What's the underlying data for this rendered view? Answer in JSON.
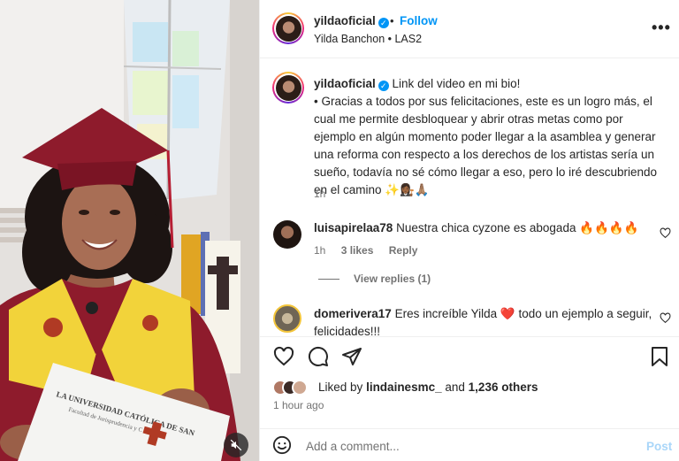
{
  "header": {
    "username": "yildaoficial",
    "separator": "•",
    "follow_label": "Follow",
    "subtitle": "Yilda Banchon • LAS2",
    "more_icon": "more-horizontal-icon"
  },
  "caption": {
    "username": "yildaoficial",
    "lines": [
      "Link del video en mi bio!",
      "• Gracias a todos por sus felicitaciones, este es un logro más, el",
      "cual me permite desbloquear y abrir otras metas como por",
      "ejemplo en algún momento poder llegar a la asamblea y generar",
      "una reforma con respecto a los derechos de los artistas sería un",
      "sueño, todavía no sé cómo llegar a eso, pero lo iré descubriendo",
      "en el camino ✨👩🏾‍⚖️🙏🏽"
    ],
    "time": "1h"
  },
  "comments": [
    {
      "username": "luisapirelaa78",
      "text": "Nuestra chica cyzone es abogada 🔥🔥🔥🔥",
      "time": "1h",
      "likes": "3 likes",
      "reply_label": "Reply",
      "view_replies": "View replies (1)"
    },
    {
      "username": "domerivera17",
      "text_line1": "Eres increíble Yilda ❤️ todo un ejemplo a seguir,",
      "text_line2": "felicidades!!!"
    }
  ],
  "likes": {
    "prefix": "Liked by",
    "user": "lindainesmc_",
    "conjunction": "and",
    "others": "1,236 others"
  },
  "post_time": "1 hour ago",
  "add_comment": {
    "placeholder": "Add a comment...",
    "post_label": "Post"
  },
  "media": {
    "mute_icon": "speaker-muted-icon",
    "diploma_line1": "LA UNIVERSIDAD CATÓLICA DE SAN",
    "diploma_line2": "Facultad de Jurisprudencia y C"
  },
  "colors": {
    "accent": "#0095f6",
    "post_disabled": "#a9d6f9",
    "gown": "#8e1b2c",
    "stole": "#f2d33a"
  }
}
